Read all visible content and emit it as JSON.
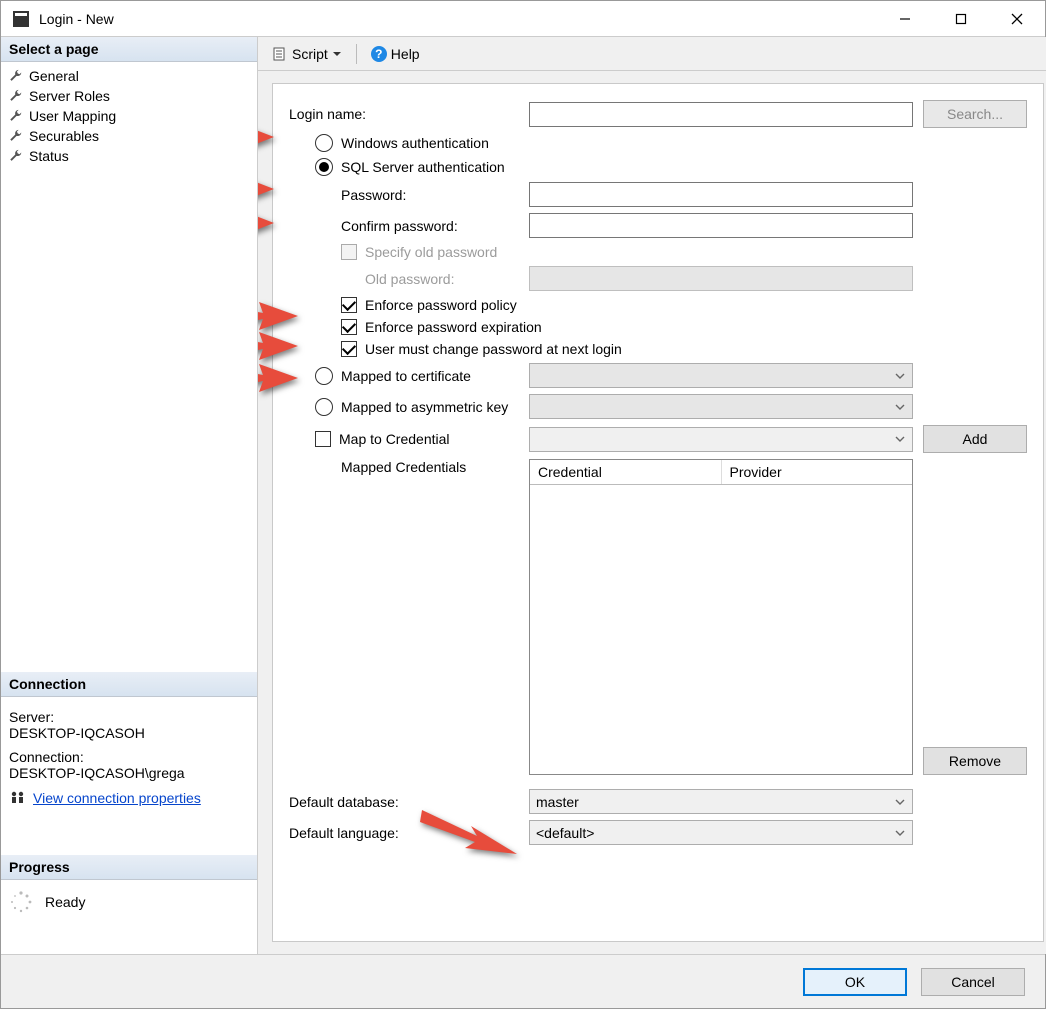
{
  "window": {
    "title": "Login - New"
  },
  "sidebar": {
    "heading": "Select a page",
    "pages": [
      "General",
      "Server Roles",
      "User Mapping",
      "Securables",
      "Status"
    ],
    "connection_heading": "Connection",
    "server_label": "Server:",
    "server_value": "DESKTOP-IQCASOH",
    "conn_label": "Connection:",
    "conn_value": "DESKTOP-IQCASOH\\grega",
    "conn_link": "View connection properties",
    "progress_heading": "Progress",
    "progress_text": "Ready"
  },
  "toolbar": {
    "script": "Script",
    "help": "Help"
  },
  "form": {
    "login_name_label": "Login name:",
    "search_btn": "Search...",
    "win_auth": "Windows authentication",
    "sql_auth": "SQL Server authentication",
    "password_label": "Password:",
    "confirm_label": "Confirm password:",
    "specify_old": "Specify old password",
    "old_password_label": "Old password:",
    "enforce_policy": "Enforce password policy",
    "enforce_expire": "Enforce password expiration",
    "must_change": "User must change password at next login",
    "mapped_cert": "Mapped to certificate",
    "mapped_asym": "Mapped to asymmetric key",
    "map_cred": "Map to Credential",
    "add_btn": "Add",
    "mapped_creds": "Mapped Credentials",
    "col_credential": "Credential",
    "col_provider": "Provider",
    "remove_btn": "Remove",
    "def_db_label": "Default database:",
    "def_db_value": "master",
    "def_lang_label": "Default language:",
    "def_lang_value": "<default>"
  },
  "footer": {
    "ok": "OK",
    "cancel": "Cancel"
  }
}
